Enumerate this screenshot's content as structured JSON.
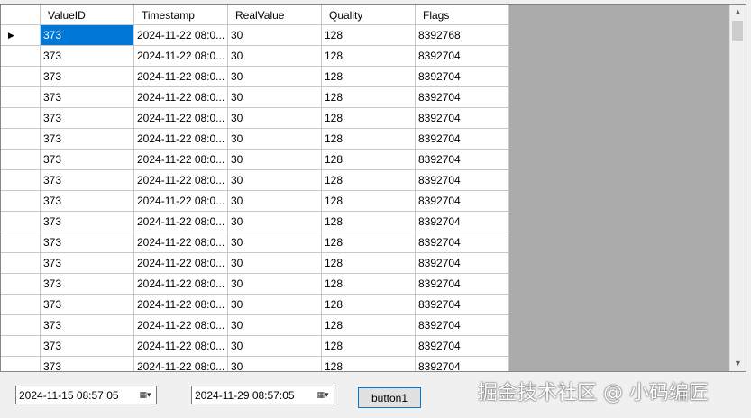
{
  "grid": {
    "columns": [
      "ValueID",
      "Timestamp",
      "RealValue",
      "Quality",
      "Flags"
    ],
    "current_row_marker": "▶",
    "rows": [
      [
        "373",
        "2024-11-22 08:0...",
        "30",
        "128",
        "8392768"
      ],
      [
        "373",
        "2024-11-22 08:0...",
        "30",
        "128",
        "8392704"
      ],
      [
        "373",
        "2024-11-22 08:0...",
        "30",
        "128",
        "8392704"
      ],
      [
        "373",
        "2024-11-22 08:0...",
        "30",
        "128",
        "8392704"
      ],
      [
        "373",
        "2024-11-22 08:0...",
        "30",
        "128",
        "8392704"
      ],
      [
        "373",
        "2024-11-22 08:0...",
        "30",
        "128",
        "8392704"
      ],
      [
        "373",
        "2024-11-22 08:0...",
        "30",
        "128",
        "8392704"
      ],
      [
        "373",
        "2024-11-22 08:0...",
        "30",
        "128",
        "8392704"
      ],
      [
        "373",
        "2024-11-22 08:0...",
        "30",
        "128",
        "8392704"
      ],
      [
        "373",
        "2024-11-22 08:0...",
        "30",
        "128",
        "8392704"
      ],
      [
        "373",
        "2024-11-22 08:0...",
        "30",
        "128",
        "8392704"
      ],
      [
        "373",
        "2024-11-22 08:0...",
        "30",
        "128",
        "8392704"
      ],
      [
        "373",
        "2024-11-22 08:0...",
        "30",
        "128",
        "8392704"
      ],
      [
        "373",
        "2024-11-22 08:0...",
        "30",
        "128",
        "8392704"
      ],
      [
        "373",
        "2024-11-22 08:0...",
        "30",
        "128",
        "8392704"
      ],
      [
        "373",
        "2024-11-22 08:0...",
        "30",
        "128",
        "8392704"
      ],
      [
        "373",
        "2024-11-22 08:0...",
        "30",
        "128",
        "8392704"
      ]
    ]
  },
  "start_picker": {
    "value": "2024-11-15 08:57:05",
    "icon": "calendar-dropdown-icon"
  },
  "end_picker": {
    "value": "2024-11-29 08:57:05",
    "icon": "calendar-dropdown-icon"
  },
  "button": {
    "label": "button1"
  },
  "watermark": "掘金技术社区 @ 小码编匠",
  "colors": {
    "selection": "#0078d7",
    "grid_background": "#ababab"
  }
}
